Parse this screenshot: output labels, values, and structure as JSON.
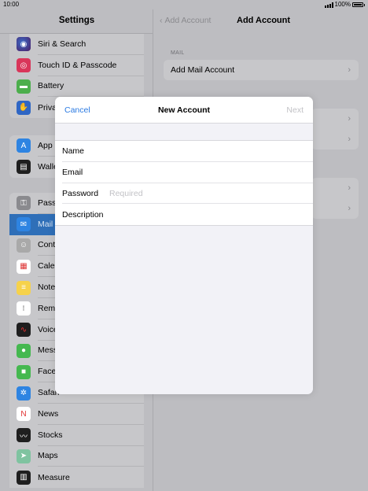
{
  "status": {
    "time": "10:00",
    "battery": "100%"
  },
  "sidebar": {
    "title": "Settings",
    "groups": [
      {
        "items": [
          {
            "label": "Siri & Search",
            "icon": "siri-icon"
          },
          {
            "label": "Touch ID & Passcode",
            "icon": "fingerprint-icon"
          },
          {
            "label": "Battery",
            "icon": "battery-icon"
          },
          {
            "label": "Priva",
            "icon": "privacy-hand-icon"
          }
        ]
      },
      {
        "items": [
          {
            "label": "App",
            "icon": "app-store-icon"
          },
          {
            "label": "Walle",
            "icon": "wallet-icon"
          }
        ]
      },
      {
        "items": [
          {
            "label": "Pass",
            "icon": "key-icon"
          },
          {
            "label": "Mail",
            "icon": "mail-icon",
            "selected": true
          },
          {
            "label": "Conta",
            "icon": "contacts-icon"
          },
          {
            "label": "Cale",
            "icon": "calendar-icon"
          },
          {
            "label": "Note",
            "icon": "notes-icon"
          },
          {
            "label": "Remi",
            "icon": "reminders-icon"
          },
          {
            "label": "Voice",
            "icon": "voice-memos-icon"
          },
          {
            "label": "Mess",
            "icon": "messages-icon"
          },
          {
            "label": "Face",
            "icon": "facetime-icon"
          },
          {
            "label": "Safari",
            "icon": "safari-icon"
          },
          {
            "label": "News",
            "icon": "news-icon"
          },
          {
            "label": "Stocks",
            "icon": "stocks-icon"
          },
          {
            "label": "Maps",
            "icon": "maps-icon"
          },
          {
            "label": "Measure",
            "icon": "measure-icon"
          }
        ]
      }
    ]
  },
  "detail": {
    "back_label": "Add Account",
    "title": "Add Account",
    "section_label": "MAIL",
    "add_mail_account": "Add Mail Account"
  },
  "modal": {
    "cancel": "Cancel",
    "title": "New Account",
    "next": "Next",
    "fields": [
      {
        "label": "Name",
        "placeholder": ""
      },
      {
        "label": "Email",
        "placeholder": ""
      },
      {
        "label": "Password",
        "placeholder": "Required"
      },
      {
        "label": "Description",
        "placeholder": ""
      }
    ]
  }
}
